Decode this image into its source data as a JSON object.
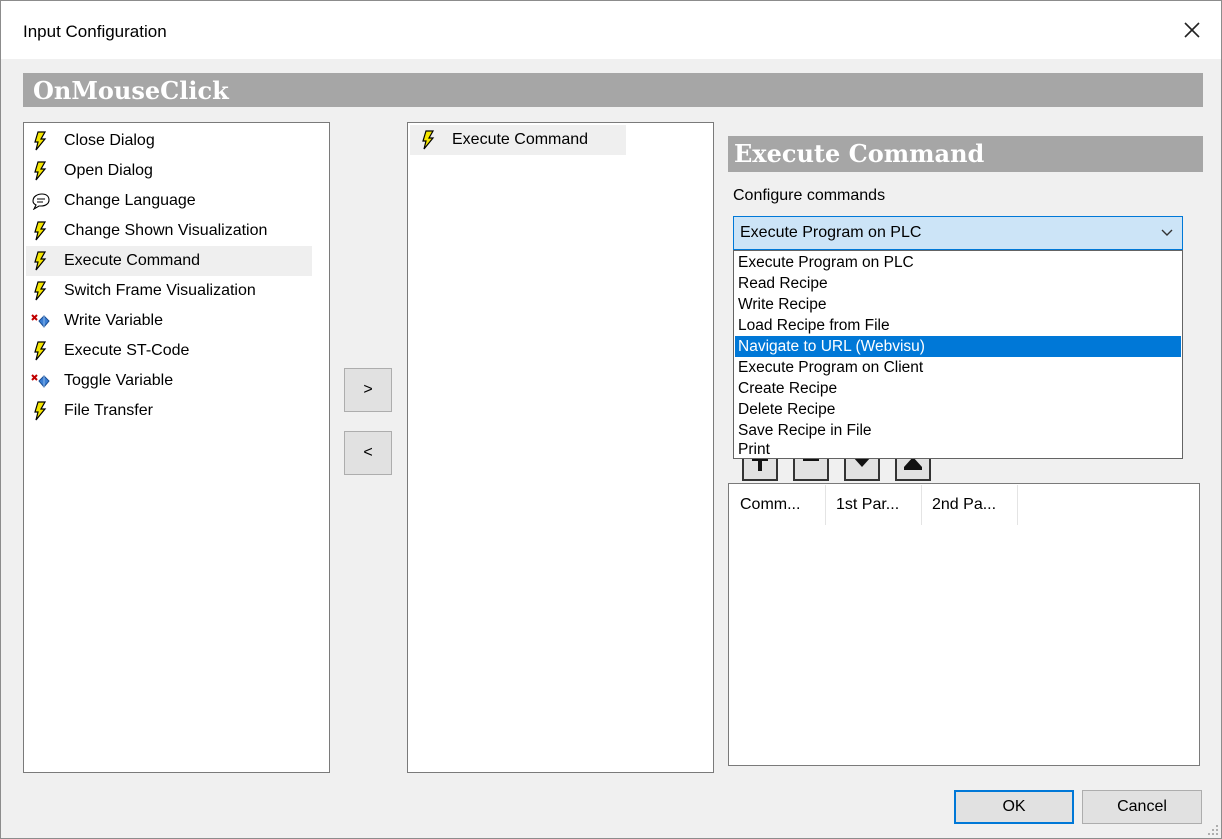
{
  "window": {
    "title": "Input Configuration"
  },
  "event": {
    "title": "OnMouseClick"
  },
  "actions": {
    "items": [
      {
        "label": "Close Dialog",
        "icon": "lightning-icon"
      },
      {
        "label": "Open Dialog",
        "icon": "lightning-icon"
      },
      {
        "label": "Change Language",
        "icon": "speech-bubble-icon"
      },
      {
        "label": "Change Shown Visualization",
        "icon": "lightning-icon"
      },
      {
        "label": "Execute Command",
        "icon": "lightning-icon",
        "selected": true
      },
      {
        "label": "Switch Frame Visualization",
        "icon": "lightning-icon"
      },
      {
        "label": "Write Variable",
        "icon": "write-variable-icon"
      },
      {
        "label": "Execute ST-Code",
        "icon": "lightning-icon"
      },
      {
        "label": "Toggle Variable",
        "icon": "write-variable-icon"
      },
      {
        "label": "File Transfer",
        "icon": "lightning-icon"
      }
    ]
  },
  "transfer": {
    "add_label": ">",
    "remove_label": "<"
  },
  "selected_actions": {
    "items": [
      {
        "label": "Execute Command",
        "icon": "lightning-icon"
      }
    ]
  },
  "command_panel": {
    "title": "Execute Command",
    "configure_label": "Configure commands",
    "combo_value": "Execute Program on PLC",
    "options": [
      "Execute Program on PLC",
      "Read Recipe",
      "Write Recipe",
      "Load Recipe from File",
      "Navigate to URL (Webvisu)",
      "Execute Program on Client",
      "Create Recipe",
      "Delete Recipe",
      "Save Recipe in File",
      "Print"
    ],
    "highlighted_option": "Navigate to URL (Webvisu)",
    "toolbar": [
      "add-icon",
      "remove-icon",
      "move-down-icon",
      "move-up-icon"
    ],
    "columns": [
      "Comm...",
      "1st Par...",
      "2nd Pa..."
    ]
  },
  "footer": {
    "ok_label": "OK",
    "cancel_label": "Cancel"
  },
  "colors": {
    "accent": "#0078d7",
    "header_gray": "#a6a6a6",
    "lightning": "#f5e600"
  }
}
